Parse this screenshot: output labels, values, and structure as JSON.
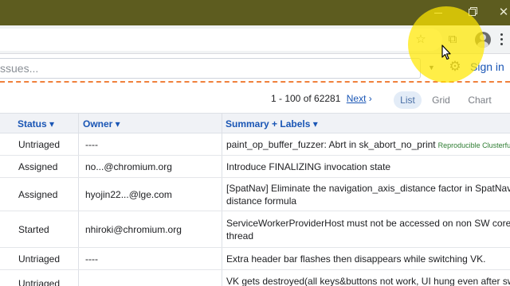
{
  "window": {
    "minimize_icon": "minimize-icon",
    "maximize_icon": "restore-icon",
    "close_glyph": "✕"
  },
  "browser": {
    "star_glyph": "☆",
    "extension_glyph": "⧉"
  },
  "issue_header": {
    "search_placeholder": "ssues...",
    "dropdown_glyph": "▼",
    "gear_glyph": "⚙",
    "sign_in": "Sign in"
  },
  "pager": {
    "range": "1 - 100 of 62281",
    "next": "Next",
    "next_arrow": "›"
  },
  "views": {
    "list": "List",
    "grid": "Grid",
    "chart": "Chart",
    "active": "List"
  },
  "table": {
    "headers": {
      "status": "Status ▾",
      "owner": "Owner ▾",
      "summary": "Summary + Labels ▾"
    },
    "rows": [
      {
        "status": "Untriaged",
        "owner": "----",
        "summary_line1": "paint_op_buffer_fuzzer: Abrt in sk_abort_no_print",
        "summary_line2": "",
        "label": "Reproducible Clusterfuzz"
      },
      {
        "status": "Assigned",
        "owner": "no...@chromium.org",
        "summary_line1": "Introduce FINALIZING invocation state",
        "summary_line2": "",
        "label": ""
      },
      {
        "status": "Assigned",
        "owner": "hyojin22...@lge.com",
        "summary_line1": "[SpatNav] Eliminate the navigation_axis_distance factor in SpatNav",
        "summary_line2": "distance formula",
        "label": ""
      },
      {
        "status": "Started",
        "owner": "nhiroki@chromium.org",
        "summary_line1": "ServiceWorkerProviderHost must not be accessed on non SW core",
        "summary_line2": "thread",
        "label": ""
      },
      {
        "status": "Untriaged",
        "owner": "----",
        "summary_line1": "Extra header bar flashes then disappears while switching VK.",
        "summary_line2": "",
        "label": ""
      },
      {
        "status": "Untriaged",
        "owner": "",
        "summary_line1": "VK gets destroyed(all keys&buttons not work, UI hung even after sw",
        "summary_line2": "",
        "label": ""
      }
    ]
  },
  "colors": {
    "titlebar": "#5d5c1f",
    "link": "#1a56b5",
    "dashed_rule": "#f0813c",
    "highlight": "#ffe800"
  }
}
